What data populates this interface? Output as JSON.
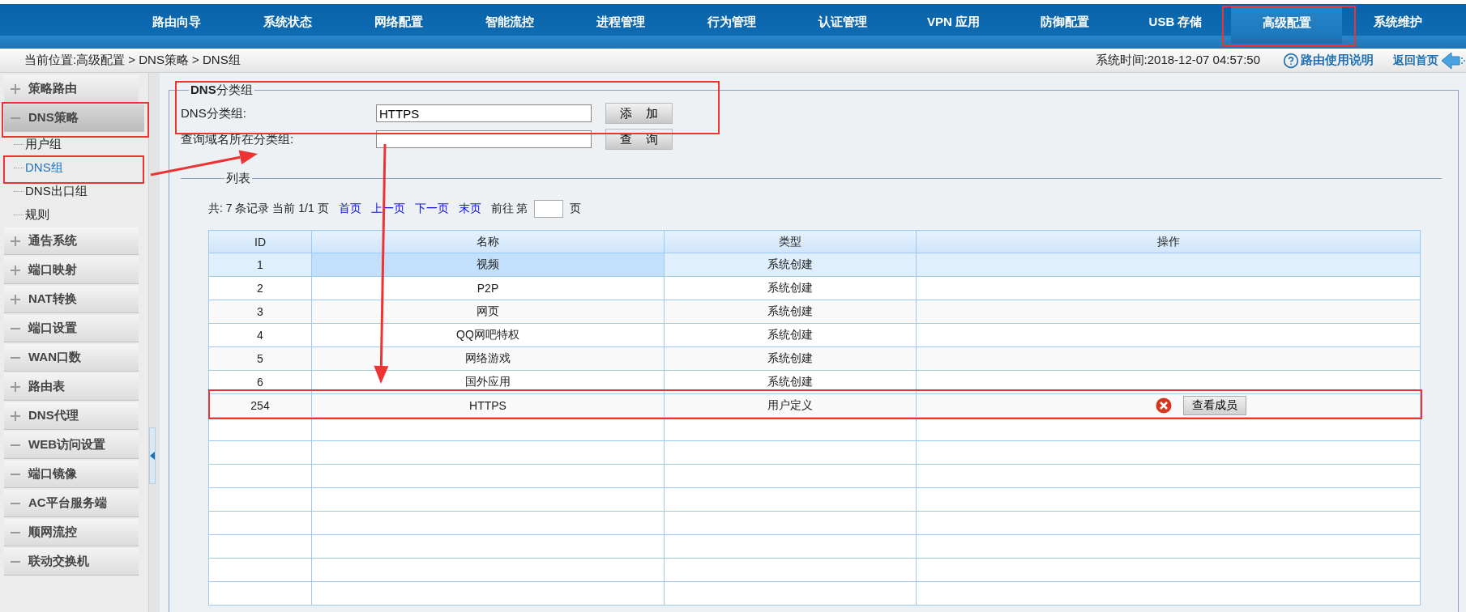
{
  "nav": [
    {
      "label": "路由向导",
      "selected": false
    },
    {
      "label": "系统状态",
      "selected": false
    },
    {
      "label": "网络配置",
      "selected": false
    },
    {
      "label": "智能流控",
      "selected": false
    },
    {
      "label": "进程管理",
      "selected": false
    },
    {
      "label": "行为管理",
      "selected": false
    },
    {
      "label": "认证管理",
      "selected": false
    },
    {
      "label": "VPN 应用",
      "selected": false
    },
    {
      "label": "防御配置",
      "selected": false
    },
    {
      "label": "USB 存储",
      "selected": false
    },
    {
      "label": "高级配置",
      "selected": true
    },
    {
      "label": "系统维护",
      "selected": false
    }
  ],
  "breadcrumb": "当前位置:高级配置 > DNS策略 > DNS组",
  "system_time": "系统时间:2018-12-07 04:57:50",
  "help_link": "路由使用说明",
  "home_link": "返回首页",
  "sidebar": [
    {
      "label": "策略路由",
      "expanded": false,
      "selected": false
    },
    {
      "label": "DNS策略",
      "expanded": true,
      "selected": true,
      "children": [
        {
          "label": "用户组",
          "selected": false
        },
        {
          "label": "DNS组",
          "selected": true
        },
        {
          "label": "DNS出口组",
          "selected": false
        },
        {
          "label": "规则",
          "selected": false
        }
      ]
    },
    {
      "label": "通告系统",
      "expanded": false,
      "selected": false
    },
    {
      "label": "端口映射",
      "expanded": false,
      "selected": false
    },
    {
      "label": "NAT转换",
      "expanded": false,
      "selected": false
    },
    {
      "label": "端口设置",
      "expanded": true,
      "selected": false
    },
    {
      "label": "WAN口数",
      "expanded": true,
      "selected": false
    },
    {
      "label": "路由表",
      "expanded": false,
      "selected": false
    },
    {
      "label": "DNS代理",
      "expanded": false,
      "selected": false
    },
    {
      "label": "WEB访问设置",
      "expanded": true,
      "selected": false
    },
    {
      "label": "端口镜像",
      "expanded": true,
      "selected": false
    },
    {
      "label": "AC平台服务端",
      "expanded": true,
      "selected": false
    },
    {
      "label": "顺网流控",
      "expanded": true,
      "selected": false
    },
    {
      "label": "联动交换机",
      "expanded": true,
      "selected": false
    }
  ],
  "form": {
    "legend": "**DNS**分类组",
    "rows": [
      {
        "label": "DNS分类组:",
        "value": "HTTPS",
        "button": "添 加"
      },
      {
        "label": "查询域名所在分类组:",
        "button": "查 询"
      }
    ]
  },
  "list": {
    "legend": "列表",
    "summary": "共: 7 条记录 当前 1/1 页",
    "page_links": [
      "首页",
      "上一页",
      "下一页",
      "末页"
    ],
    "goto_prefix": "前往 第",
    "goto_suffix": "页",
    "columns": [
      "ID",
      "名称",
      "类型",
      "操作"
    ],
    "rows": [
      {
        "id": "1",
        "name": "视频",
        "type": "系统创建",
        "selected": true,
        "deletable": false
      },
      {
        "id": "2",
        "name": "P2P",
        "type": "系统创建",
        "selected": false,
        "deletable": false
      },
      {
        "id": "3",
        "name": "网页",
        "type": "系统创建",
        "selected": false,
        "deletable": false
      },
      {
        "id": "4",
        "name": "QQ网吧特权",
        "type": "系统创建",
        "selected": false,
        "deletable": false
      },
      {
        "id": "5",
        "name": "网络游戏",
        "type": "系统创建",
        "selected": false,
        "deletable": false
      },
      {
        "id": "6",
        "name": "国外应用",
        "type": "系统创建",
        "selected": false,
        "deletable": false
      },
      {
        "id": "254",
        "name": "HTTPS",
        "type": "用户定义",
        "selected": false,
        "deletable": true,
        "button": "查看成员"
      }
    ]
  }
}
